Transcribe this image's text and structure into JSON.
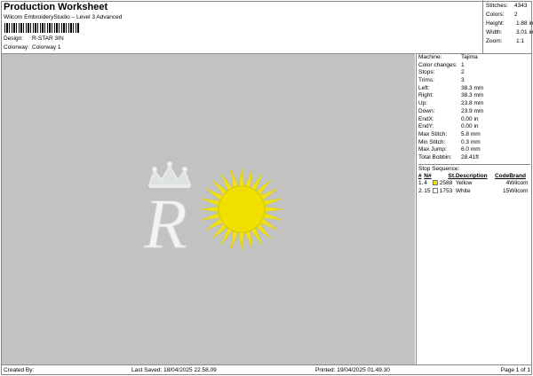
{
  "header": {
    "title": "Production Worksheet",
    "subtitle": "Wilcom EmbroideryStudio – Level 3 Advanced",
    "design_label": "Design:",
    "design": "R-STAR 3IN",
    "colorway_label": "Colorway:",
    "colorway": "Colorway 1"
  },
  "stats": [
    {
      "label": "Stitches:",
      "value": "4343"
    },
    {
      "label": "Colors:",
      "value": "2"
    },
    {
      "label": "Height:",
      "value": "1.88 in"
    },
    {
      "label": "Width:",
      "value": "3.01 in"
    },
    {
      "label": "Zoom:",
      "value": "1:1"
    }
  ],
  "details": [
    {
      "label": "Machine:",
      "value": "Tajima"
    },
    {
      "label": "Color changes:",
      "value": "1"
    },
    {
      "label": "Stops:",
      "value": "2"
    },
    {
      "label": "Trims:",
      "value": "3"
    },
    {
      "label": "Left:",
      "value": "38.3 mm"
    },
    {
      "label": "Right:",
      "value": "38.3 mm"
    },
    {
      "label": "Up:",
      "value": "23.8 mm"
    },
    {
      "label": "Down:",
      "value": "23.9 mm"
    },
    {
      "label": "EndX:",
      "value": "0.00 in"
    },
    {
      "label": "EndY:",
      "value": "0.00 in"
    },
    {
      "label": "Max Stitch:",
      "value": "5.8 mm"
    },
    {
      "label": "Min Stitch:",
      "value": "0.3 mm"
    },
    {
      "label": "Max Jump:",
      "value": "6.0 mm"
    },
    {
      "label": "Total Bobbin:",
      "value": "28.41ft"
    }
  ],
  "stop_sequence": {
    "title": "Stop Sequence:",
    "headers": [
      "#",
      "N#",
      "St.",
      "Description",
      "Code",
      "Brand"
    ],
    "rows": [
      {
        "idx": "1.",
        "n": "4",
        "color": "#f0e000",
        "st": "2588",
        "desc": "Yellow",
        "code": "4",
        "brand": "Wilcom"
      },
      {
        "idx": "2.",
        "n": "15",
        "color": "#ffffff",
        "st": "1753",
        "desc": "White",
        "code": "15",
        "brand": "Wilcom"
      }
    ]
  },
  "footer": {
    "created": "Created By:",
    "saved": "Last Saved: 18/04/2025 22.58.09",
    "printed": "Printed: 19/04/2025 01.49.30",
    "page": "Page 1 of 1"
  }
}
